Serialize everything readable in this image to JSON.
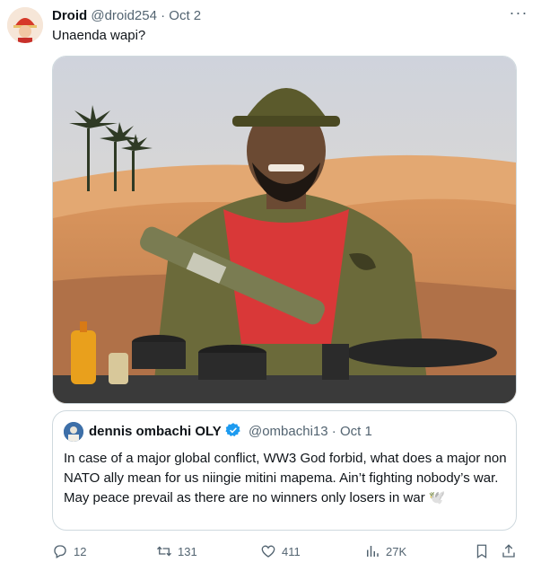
{
  "tweet": {
    "author_name": "Droid",
    "author_handle": "@droid254",
    "separator": "·",
    "date": "Oct 2",
    "text": "Unaenda wapi?",
    "more_icon": "more-dots-icon"
  },
  "quote": {
    "author_name": "dennis ombachi OLY",
    "author_handle": "@ombachi13",
    "separator": "·",
    "date": "Oct 1",
    "text": "In case of a major global conflict, WW3 God forbid, what does a major non NATO ally mean for us niingie mitini mapema. Ain’t fighting nobody’s war. May peace prevail as there are no winners only losers in war 🕊️",
    "verified_color": "#1d9bf0"
  },
  "actions": {
    "replies": "12",
    "reposts": "131",
    "likes": "411",
    "views": "27K"
  },
  "colors": {
    "text": "#0f1419",
    "secondary": "#536471",
    "border": "#cfd9de",
    "accent": "#1d9bf0"
  }
}
